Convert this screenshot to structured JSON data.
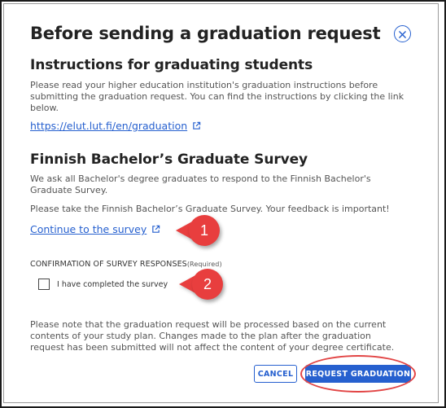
{
  "dialog": {
    "title": "Before sending a graduation request",
    "close_icon": "close-circle-icon"
  },
  "instructions": {
    "heading": "Instructions for graduating students",
    "text": "Please read your higher education institution's graduation instructions before submitting the graduation request. You can find the instructions by clicking the link below.",
    "link_label": "https://elut.lut.fi/en/graduation",
    "link_icon": "external-link-icon"
  },
  "survey": {
    "heading": "Finnish Bachelor’s Graduate Survey",
    "text1": "We ask all Bachelor's degree graduates to respond to the Finnish Bachelor's Graduate Survey.",
    "text2": "Please take the Finnish Bachelor’s Graduate Survey. Your feedback is important!",
    "link_label": "Continue to the survey",
    "link_icon": "external-link-icon"
  },
  "confirmation": {
    "label": "CONFIRMATION OF SURVEY RESPONSES",
    "required": "(Required)",
    "checkbox_label": "I have completed the survey",
    "checked": false
  },
  "note": {
    "text": "Please note that the graduation request will be processed based on the current contents of your study plan. Changes made to the plan after the graduation request has been submitted will not affect the content of your degree certificate."
  },
  "buttons": {
    "cancel": "CANCEL",
    "request": "REQUEST GRADUATION"
  },
  "annotations": {
    "badge1": "1",
    "badge2": "2"
  },
  "colors": {
    "accent": "#2660cf",
    "annotation_red": "#e83e3e"
  }
}
